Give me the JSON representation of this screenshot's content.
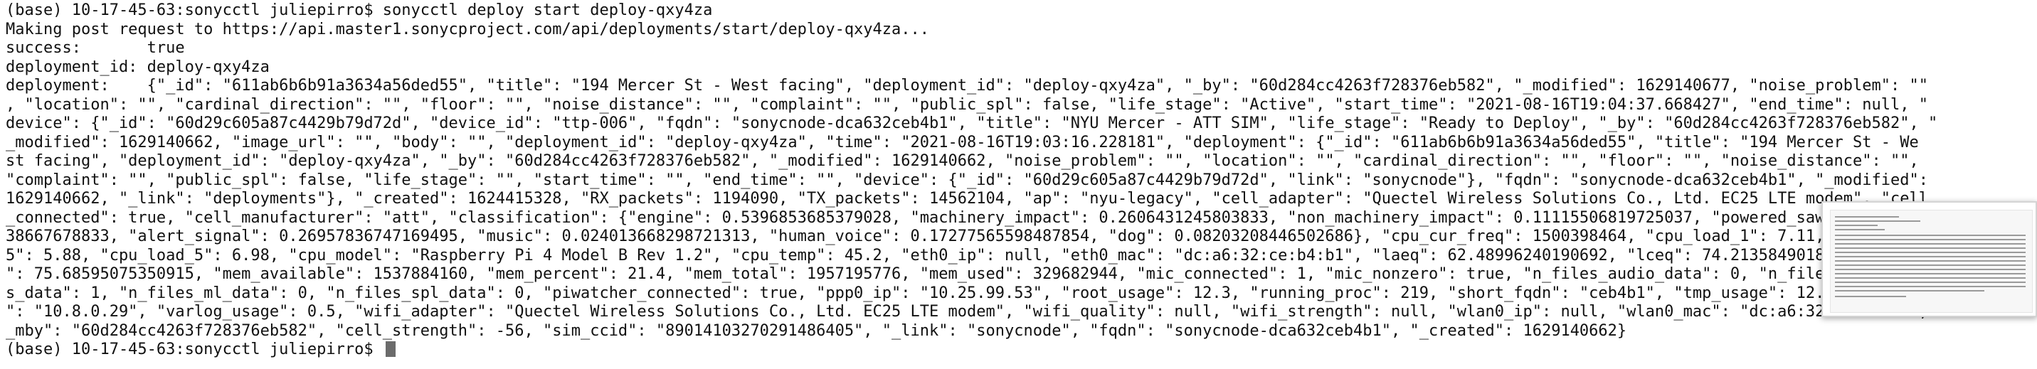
{
  "terminal": {
    "lines": [
      "(base) 10-17-45-63:sonycctl juliepirro$ sonycctl deploy start deploy-qxy4za",
      "Making post request to https://api.master1.sonycproject.com/api/deployments/start/deploy-qxy4za...",
      "success:       true",
      "deployment_id: deploy-qxy4za",
      "deployment:    {\"_id\": \"611ab6b6b91a3634a56ded55\", \"title\": \"194 Mercer St - West facing\", \"deployment_id\": \"deploy-qxy4za\", \"_by\": \"60d284cc4263f728376eb582\", \"_modified\": 1629140677, \"noise_problem\": \"\"",
      ", \"location\": \"\", \"cardinal_direction\": \"\", \"floor\": \"\", \"noise_distance\": \"\", \"complaint\": \"\", \"public_spl\": false, \"life_stage\": \"Active\", \"start_time\": \"2021-08-16T19:04:37.668427\", \"end_time\": null, \"",
      "device\": {\"_id\": \"60d29c605a87c4429b79d72d\", \"device_id\": \"ttp-006\", \"fqdn\": \"sonycnode-dca632ceb4b1\", \"title\": \"NYU Mercer - ATT SIM\", \"life_stage\": \"Ready to Deploy\", \"_by\": \"60d284cc4263f728376eb582\", \"",
      "_modified\": 1629140662, \"image_url\": \"\", \"body\": \"\", \"deployment_id\": \"deploy-qxy4za\", \"time\": \"2021-08-16T19:03:16.228181\", \"deployment\": {\"_id\": \"611ab6b6b91a3634a56ded55\", \"title\": \"194 Mercer St - We",
      "st facing\", \"deployment_id\": \"deploy-qxy4za\", \"_by\": \"60d284cc4263f728376eb582\", \"_modified\": 1629140662, \"noise_problem\": \"\", \"location\": \"\", \"cardinal_direction\": \"\", \"floor\": \"\", \"noise_distance\": \"\",",
      "\"complaint\": \"\", \"public_spl\": false, \"life_stage\": \"\", \"start_time\": \"\", \"end_time\": \"\", \"device\": {\"_id\": \"60d29c605a87c4429b79d72d\", \"link\": \"sonycnode\"}, \"fqdn\": \"sonycnode-dca632ceb4b1\", \"_modified\":",
      "1629140662, \"_link\": \"deployments\"}, \"_created\": 1624415328, \"RX_packets\": 1194090, \"TX_packets\": 14562104, \"ap\": \"nyu-legacy\", \"cell_adapter\": \"Quectel Wireless Solutions Co., Ltd. EC25 LTE modem\", \"cell",
      "_connected\": true, \"cell_manufacturer\": \"att\", \"classification\": {\"engine\": 0.5396853685379028, \"machinery_impact\": 0.2606431245803833, \"non_machinery_impact\": 0.11115506819725037, \"powered_saw\": 0.01",
      "38667678833, \"alert_signal\": 0.26957836747169495, \"music\": 0.024013668298721313, \"human_voice\": 0.17277565598487854, \"dog\": 0.08203208446502686}, \"cpu_cur_freq\": 1500398464, \"cpu_load_1\": 7.11, \"cpu_load_1",
      "5\": 5.88, \"cpu_load_5\": 6.98, \"cpu_model\": \"Raspberry Pi 4 Model B Rev 1.2\", \"cpu_temp\": 45.2, \"eth0_ip\": null, \"eth0_mac\": \"dc:a6:32:ce:b4:b1\", \"laeq\": 62.48996240190692, \"lceq\": 74.21358490180969, \"lzeq",
      "\": 75.68595075350915, \"mem_available\": 1537884160, \"mem_percent\": 21.4, \"mem_total\": 1957195776, \"mem_used\": 329682944, \"mic_connected\": 1, \"mic_nonzero\": true, \"n_files_audio_data\": 0, \"n_file",
      "s_data\": 1, \"n_files_ml_data\": 0, \"n_files_spl_data\": 0, \"piwatcher_connected\": true, \"ppp0_ip\": \"10.25.99.53\", \"root_usage\": 12.3, \"running_proc\": 219, \"short_fqdn\": \"ceb4b1\", \"tmp_usage\": 12.3, \"tune_ip",
      "\": \"10.8.0.29\", \"varlog_usage\": 0.5, \"wifi_adapter\": \"Quectel Wireless Solutions Co., Ltd. EC25 LTE modem\", \"wifi_quality\": null, \"wifi_strength\": null, \"wlan0_ip\": null, \"wlan0_mac\": \"dc:a6:32:ce:b4:b2\", \"",
      "_mby\": \"60d284cc4263f728376eb582\", \"cell_strength\": -56, \"sim_ccid\": \"89014103270291486405\", \"_link\": \"sonycnode\", \"fqdn\": \"sonycnode-dca632ceb4b1\", \"_created\": 1629140662}",
      "(base) 10-17-45-63:sonycctl juliepirro$ "
    ]
  },
  "colors": {
    "background": "#ffffff",
    "text": "#111111",
    "cursor": "#6b6b6b"
  }
}
